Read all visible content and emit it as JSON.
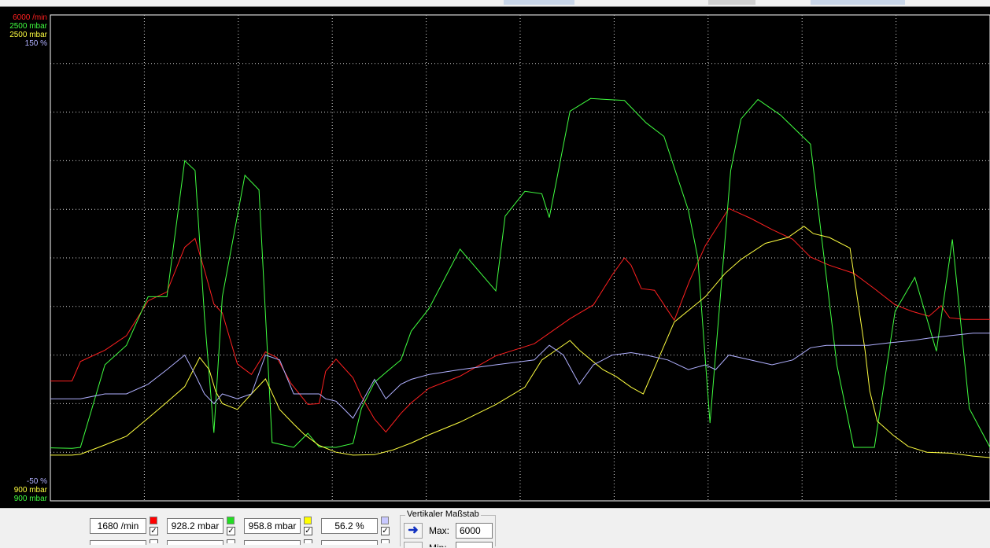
{
  "chart_data": {
    "type": "line",
    "x_range": [
      0,
      100
    ],
    "grid": true,
    "axes_scales": [
      {
        "top_label": "6000 /min",
        "bottom_label": "",
        "max": 6000,
        "min": 0,
        "color": "#ff2020"
      },
      {
        "top_label": "2500 mbar",
        "bottom_label": "900 mbar",
        "max": 2500,
        "min": 900,
        "color": "#40ff40"
      },
      {
        "top_label": "2500 mbar",
        "bottom_label": "900 mbar",
        "max": 2500,
        "min": 900,
        "color": "#ffff40"
      },
      {
        "top_label": "150 %",
        "bottom_label": "-50 %",
        "max": 150,
        "min": -50,
        "color": "#b0b0ff"
      }
    ],
    "series": [
      {
        "color": "#ff2020",
        "axis": 0,
        "points": [
          [
            0,
            1480
          ],
          [
            2.3,
            1480
          ],
          [
            3.2,
            1720
          ],
          [
            5.8,
            1860
          ],
          [
            8.1,
            2040
          ],
          [
            10.4,
            2470
          ],
          [
            12.4,
            2580
          ],
          [
            14.3,
            3130
          ],
          [
            15.4,
            3240
          ],
          [
            16.4,
            2850
          ],
          [
            17.4,
            2430
          ],
          [
            18.3,
            2320
          ],
          [
            19.9,
            1690
          ],
          [
            21.4,
            1560
          ],
          [
            22.9,
            1840
          ],
          [
            24.1,
            1770
          ],
          [
            25.6,
            1450
          ],
          [
            27.4,
            1190
          ],
          [
            28.6,
            1200
          ],
          [
            29.3,
            1600
          ],
          [
            30.4,
            1750
          ],
          [
            32.2,
            1520
          ],
          [
            33.1,
            1290
          ],
          [
            34.5,
            1010
          ],
          [
            35.7,
            850
          ],
          [
            37.3,
            1080
          ],
          [
            38.4,
            1210
          ],
          [
            40.3,
            1390
          ],
          [
            43.6,
            1540
          ],
          [
            47.4,
            1790
          ],
          [
            51.5,
            1940
          ],
          [
            55.3,
            2250
          ],
          [
            57.8,
            2420
          ],
          [
            59.8,
            2790
          ],
          [
            61.1,
            3000
          ],
          [
            61.8,
            2910
          ],
          [
            62.9,
            2620
          ],
          [
            64.3,
            2600
          ],
          [
            66.4,
            2230
          ],
          [
            68.0,
            2710
          ],
          [
            69.7,
            3150
          ],
          [
            72.2,
            3610
          ],
          [
            74.5,
            3490
          ],
          [
            76.8,
            3350
          ],
          [
            79.0,
            3230
          ],
          [
            80.9,
            3010
          ],
          [
            82.9,
            2910
          ],
          [
            85.5,
            2810
          ],
          [
            87.7,
            2620
          ],
          [
            89.9,
            2420
          ],
          [
            91.7,
            2340
          ],
          [
            93.5,
            2280
          ],
          [
            94.8,
            2410
          ],
          [
            95.7,
            2260
          ],
          [
            97.3,
            2240
          ],
          [
            100,
            2240
          ]
        ]
      },
      {
        "color": "#40ff40",
        "axis": 1,
        "points": [
          [
            0,
            1090
          ],
          [
            2.3,
            1080
          ],
          [
            3.2,
            1100
          ],
          [
            5.8,
            2800
          ],
          [
            8.1,
            3200
          ],
          [
            10.4,
            4200
          ],
          [
            12.4,
            4200
          ],
          [
            14.3,
            7000
          ],
          [
            15.4,
            6800
          ],
          [
            16.4,
            3800
          ],
          [
            17.4,
            1400
          ],
          [
            18.3,
            4200
          ],
          [
            20.7,
            6700
          ],
          [
            22.2,
            6400
          ],
          [
            23.6,
            1200
          ],
          [
            25.9,
            1100
          ],
          [
            27.4,
            1390
          ],
          [
            28.6,
            1110
          ],
          [
            30.4,
            1100
          ],
          [
            32.2,
            1180
          ],
          [
            33.1,
            1900
          ],
          [
            34.5,
            2440
          ],
          [
            35.7,
            2640
          ],
          [
            37.3,
            2900
          ],
          [
            38.4,
            3490
          ],
          [
            40.3,
            3960
          ],
          [
            43.6,
            5180
          ],
          [
            47.4,
            4320
          ],
          [
            48.4,
            5860
          ],
          [
            50.5,
            6370
          ],
          [
            52.3,
            6320
          ],
          [
            53.1,
            5830
          ],
          [
            55.3,
            8020
          ],
          [
            57.5,
            8280
          ],
          [
            61.1,
            8240
          ],
          [
            63.4,
            7780
          ],
          [
            65.3,
            7500
          ],
          [
            67.9,
            5980
          ],
          [
            68.9,
            5000
          ],
          [
            70.2,
            1600
          ],
          [
            72.4,
            6800
          ],
          [
            73.5,
            7860
          ],
          [
            75.3,
            8260
          ],
          [
            77.7,
            7940
          ],
          [
            80.9,
            7340
          ],
          [
            83.7,
            2800
          ],
          [
            85.5,
            1100
          ],
          [
            87.7,
            1100
          ],
          [
            89.9,
            3900
          ],
          [
            92.0,
            4600
          ],
          [
            94.3,
            3080
          ],
          [
            96.0,
            5380
          ],
          [
            97.8,
            1900
          ],
          [
            100,
            1100
          ]
        ]
      },
      {
        "color": "#ffff40",
        "axis": 2,
        "points": [
          [
            0,
            940
          ],
          [
            2.3,
            940
          ],
          [
            3.2,
            960
          ],
          [
            5.8,
            1150
          ],
          [
            8.1,
            1330
          ],
          [
            10.4,
            1700
          ],
          [
            12.4,
            2030
          ],
          [
            14.3,
            2350
          ],
          [
            15.9,
            2950
          ],
          [
            16.9,
            2700
          ],
          [
            17.6,
            2250
          ],
          [
            18.3,
            2000
          ],
          [
            19.9,
            1880
          ],
          [
            21.4,
            2200
          ],
          [
            22.9,
            2510
          ],
          [
            24.4,
            1880
          ],
          [
            25.9,
            1580
          ],
          [
            27.0,
            1370
          ],
          [
            28.6,
            1140
          ],
          [
            30.4,
            1000
          ],
          [
            32.2,
            940
          ],
          [
            34.5,
            950
          ],
          [
            36.5,
            1050
          ],
          [
            38.4,
            1190
          ],
          [
            40.3,
            1360
          ],
          [
            43.6,
            1620
          ],
          [
            47.4,
            1980
          ],
          [
            50.5,
            2340
          ],
          [
            52.3,
            2900
          ],
          [
            55.3,
            3300
          ],
          [
            56.3,
            3100
          ],
          [
            58.8,
            2700
          ],
          [
            60.2,
            2560
          ],
          [
            61.8,
            2340
          ],
          [
            63.1,
            2200
          ],
          [
            64.1,
            2650
          ],
          [
            66.4,
            3680
          ],
          [
            69.7,
            4200
          ],
          [
            71.8,
            4680
          ],
          [
            73.5,
            4970
          ],
          [
            76.1,
            5300
          ],
          [
            78.5,
            5420
          ],
          [
            80.2,
            5650
          ],
          [
            81.2,
            5500
          ],
          [
            82.9,
            5420
          ],
          [
            85.1,
            5200
          ],
          [
            86.7,
            3100
          ],
          [
            87.2,
            2260
          ],
          [
            88.0,
            1640
          ],
          [
            89.7,
            1350
          ],
          [
            91.3,
            1120
          ],
          [
            93.3,
            1000
          ],
          [
            95.8,
            980
          ],
          [
            98.2,
            920
          ],
          [
            100,
            890
          ]
        ]
      },
      {
        "color": "#b0b0ff",
        "axis": 3,
        "points": [
          [
            0,
            2100
          ],
          [
            2.3,
            2100
          ],
          [
            3.2,
            2100
          ],
          [
            5.8,
            2200
          ],
          [
            8.1,
            2200
          ],
          [
            10.4,
            2400
          ],
          [
            12.4,
            2700
          ],
          [
            14.3,
            3000
          ],
          [
            15.4,
            2600
          ],
          [
            16.4,
            2200
          ],
          [
            17.4,
            2000
          ],
          [
            18.3,
            2200
          ],
          [
            19.9,
            2100
          ],
          [
            21.4,
            2200
          ],
          [
            22.9,
            3000
          ],
          [
            24.4,
            2900
          ],
          [
            25.9,
            2200
          ],
          [
            27.0,
            2200
          ],
          [
            28.6,
            2200
          ],
          [
            29.3,
            2100
          ],
          [
            30.4,
            2050
          ],
          [
            31.2,
            1900
          ],
          [
            32.2,
            1700
          ],
          [
            34.5,
            2500
          ],
          [
            35.7,
            2100
          ],
          [
            37.3,
            2400
          ],
          [
            38.4,
            2500
          ],
          [
            40.3,
            2600
          ],
          [
            43.6,
            2700
          ],
          [
            47.4,
            2800
          ],
          [
            51.5,
            2900
          ],
          [
            53.1,
            3200
          ],
          [
            54.6,
            3000
          ],
          [
            56.3,
            2400
          ],
          [
            57.8,
            2800
          ],
          [
            59.8,
            3000
          ],
          [
            61.8,
            3050
          ],
          [
            63.4,
            3000
          ],
          [
            65.7,
            2900
          ],
          [
            67.9,
            2700
          ],
          [
            69.7,
            2800
          ],
          [
            70.8,
            2700
          ],
          [
            72.2,
            3000
          ],
          [
            74.5,
            2900
          ],
          [
            76.8,
            2800
          ],
          [
            79.0,
            2900
          ],
          [
            80.9,
            3150
          ],
          [
            82.6,
            3200
          ],
          [
            84.9,
            3200
          ],
          [
            87.0,
            3200
          ],
          [
            89.2,
            3250
          ],
          [
            91.7,
            3300
          ],
          [
            93.5,
            3350
          ],
          [
            95.8,
            3400
          ],
          [
            98.2,
            3450
          ],
          [
            100,
            3450
          ]
        ]
      }
    ]
  },
  "readouts": [
    {
      "value": "1680 /min",
      "color": "#ff0000",
      "checked": "✓"
    },
    {
      "value": "928.2 mbar",
      "color": "#22dd22",
      "checked": "✓"
    },
    {
      "value": "958.8 mbar",
      "color": "#ffff00",
      "checked": "✓"
    },
    {
      "value": "56.2 %",
      "color": "#c8c8ff",
      "checked": "✓"
    }
  ],
  "vertical_scale": {
    "title": "Vertikaler Maßstab",
    "max_label": "Max:",
    "max_value": "6000",
    "min_label": "Min:"
  }
}
